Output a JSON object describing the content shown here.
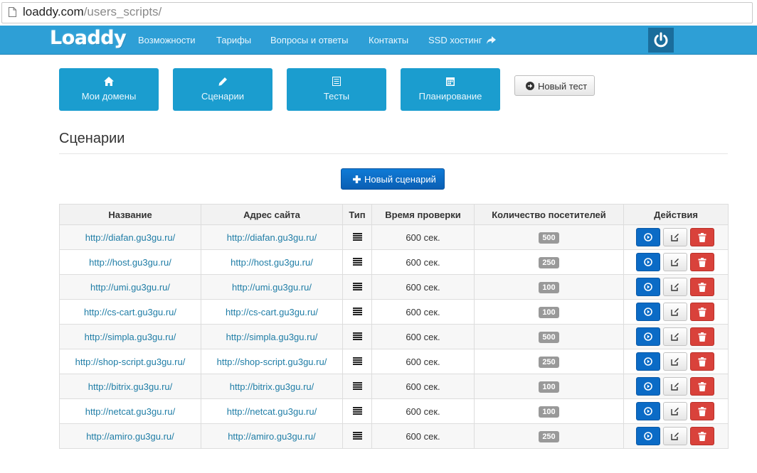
{
  "browser": {
    "url_host": "loaddy.com",
    "url_path": "/users_scripts/"
  },
  "navbar": {
    "logo": "Loaddy",
    "items": [
      {
        "label": "Возможности"
      },
      {
        "label": "Тарифы"
      },
      {
        "label": "Вопросы и ответы"
      },
      {
        "label": "Контакты"
      },
      {
        "label": "SSD хостинг"
      }
    ]
  },
  "tiles": [
    {
      "label": "Мои домены",
      "icon": "home-icon"
    },
    {
      "label": "Сценарии",
      "icon": "pencil-icon"
    },
    {
      "label": "Тесты",
      "icon": "list-icon"
    },
    {
      "label": "Планирование",
      "icon": "calendar-icon"
    }
  ],
  "new_test_label": "Новый тест",
  "section_title": "Сценарии",
  "new_script_label": "Новый сценарий",
  "table": {
    "headers": [
      "Название",
      "Адрес сайта",
      "Тип",
      "Время проверки",
      "Количество посетителей",
      "Действия"
    ],
    "rows": [
      {
        "name": "http://diafan.gu3gu.ru/",
        "url": "http://diafan.gu3gu.ru/",
        "time": "600 сек.",
        "visitors": "500"
      },
      {
        "name": "http://host.gu3gu.ru/",
        "url": "http://host.gu3gu.ru/",
        "time": "600 сек.",
        "visitors": "250"
      },
      {
        "name": "http://umi.gu3gu.ru/",
        "url": "http://umi.gu3gu.ru/",
        "time": "600 сек.",
        "visitors": "100"
      },
      {
        "name": "http://cs-cart.gu3gu.ru/",
        "url": "http://cs-cart.gu3gu.ru/",
        "time": "600 сек.",
        "visitors": "100"
      },
      {
        "name": "http://simpla.gu3gu.ru/",
        "url": "http://simpla.gu3gu.ru/",
        "time": "600 сек.",
        "visitors": "500"
      },
      {
        "name": "http://shop-script.gu3gu.ru/",
        "url": "http://shop-script.gu3gu.ru/",
        "time": "600 сек.",
        "visitors": "250"
      },
      {
        "name": "http://bitrix.gu3gu.ru/",
        "url": "http://bitrix.gu3gu.ru/",
        "time": "600 сек.",
        "visitors": "100"
      },
      {
        "name": "http://netcat.gu3gu.ru/",
        "url": "http://netcat.gu3gu.ru/",
        "time": "600 сек.",
        "visitors": "100"
      },
      {
        "name": "http://amiro.gu3gu.ru/",
        "url": "http://amiro.gu3gu.ru/",
        "time": "600 сек.",
        "visitors": "250"
      }
    ]
  },
  "colors": {
    "navbar": "#2e9fd6",
    "tile": "#1b9dcf",
    "primary_button": "#0b6bc6",
    "danger_button": "#d9423b",
    "badge": "#999999",
    "link": "#1f7da6"
  }
}
